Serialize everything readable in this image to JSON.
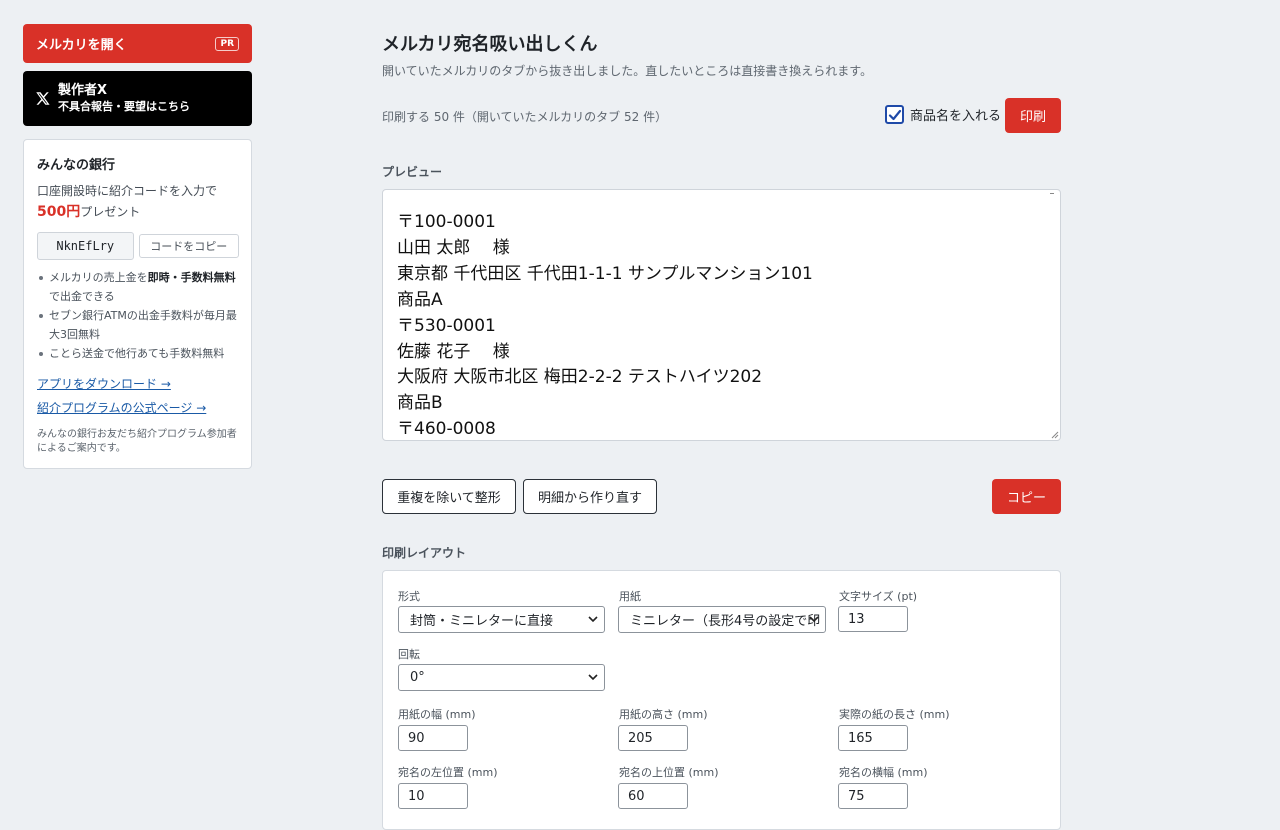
{
  "sidebar": {
    "mercari_button": {
      "label": "メルカリを開く",
      "badge": "PR"
    },
    "x_button": {
      "title": "製作者X",
      "subtitle": "不具合報告・要望はこちら"
    },
    "bank": {
      "title": "みんなの銀行",
      "desc_before": "口座開設時に紹介コードを入力で",
      "desc_amount": "500円",
      "desc_after": "プレゼント",
      "code": "NknEfLry",
      "copy_label": "コードをコピー",
      "bullets": [
        {
          "before": "メルカリの売上金を",
          "bold": "即時・手数料無料",
          "after": "で出金できる"
        },
        {
          "text": "セブン銀行ATMの出金手数料が毎月最大3回無料"
        },
        {
          "text": "ことら送金で他行あても手数料無料"
        }
      ],
      "links": [
        "アプリをダウンロード →",
        "紹介プログラムの公式ページ →"
      ],
      "note": "みんなの銀行お友だち紹介プログラム参加者によるご案内です。"
    }
  },
  "main": {
    "title": "メルカリ宛名吸い出しくん",
    "subtitle": "開いていたメルカリのタブから抜き出しました。直したいところは直接書き換えられます。",
    "print_count": "印刷する 50 件（開いていたメルカリのタブ 52 件）",
    "include_product_label": "商品名を入れる",
    "include_product_checked": true,
    "print_button": "印刷",
    "preview_label": "プレビュー",
    "preview_lines": [
      "〒100-0001",
      "山田 太郎　 様",
      "東京都 千代田区 千代田1-1-1 サンプルマンション101",
      "商品A",
      "〒530-0001",
      "佐藤 花子　 様",
      "大阪府 大阪市北区 梅田2-2-2 テストハイツ202",
      "商品B",
      "〒460-0008"
    ],
    "dedupe_button": "重複を除いて整形",
    "rebuild_button": "明細から作り直す",
    "copy_button": "コピー",
    "layout_label": "印刷レイアウト",
    "layout": {
      "format_label": "形式",
      "format_value": "封筒・ミニレターに直接",
      "paper_label": "用紙",
      "paper_value": "ミニレター（長形4号の設定で印",
      "font_size_label": "文字サイズ (pt)",
      "font_size_value": "13",
      "rotation_label": "回転",
      "rotation_value": "0°",
      "paper_width_label": "用紙の幅 (mm)",
      "paper_width_value": "90",
      "paper_height_label": "用紙の高さ (mm)",
      "paper_height_value": "205",
      "actual_length_label": "実際の紙の長さ (mm)",
      "actual_length_value": "165",
      "addr_left_label": "宛名の左位置 (mm)",
      "addr_left_value": "10",
      "addr_top_label": "宛名の上位置 (mm)",
      "addr_top_value": "60",
      "addr_width_label": "宛名の横幅 (mm)",
      "addr_width_value": "75"
    }
  },
  "colors": {
    "accent_red": "#d93128",
    "background": "#edf0f3",
    "link": "#1a5aa6",
    "checkbox": "#1f4aa8"
  }
}
